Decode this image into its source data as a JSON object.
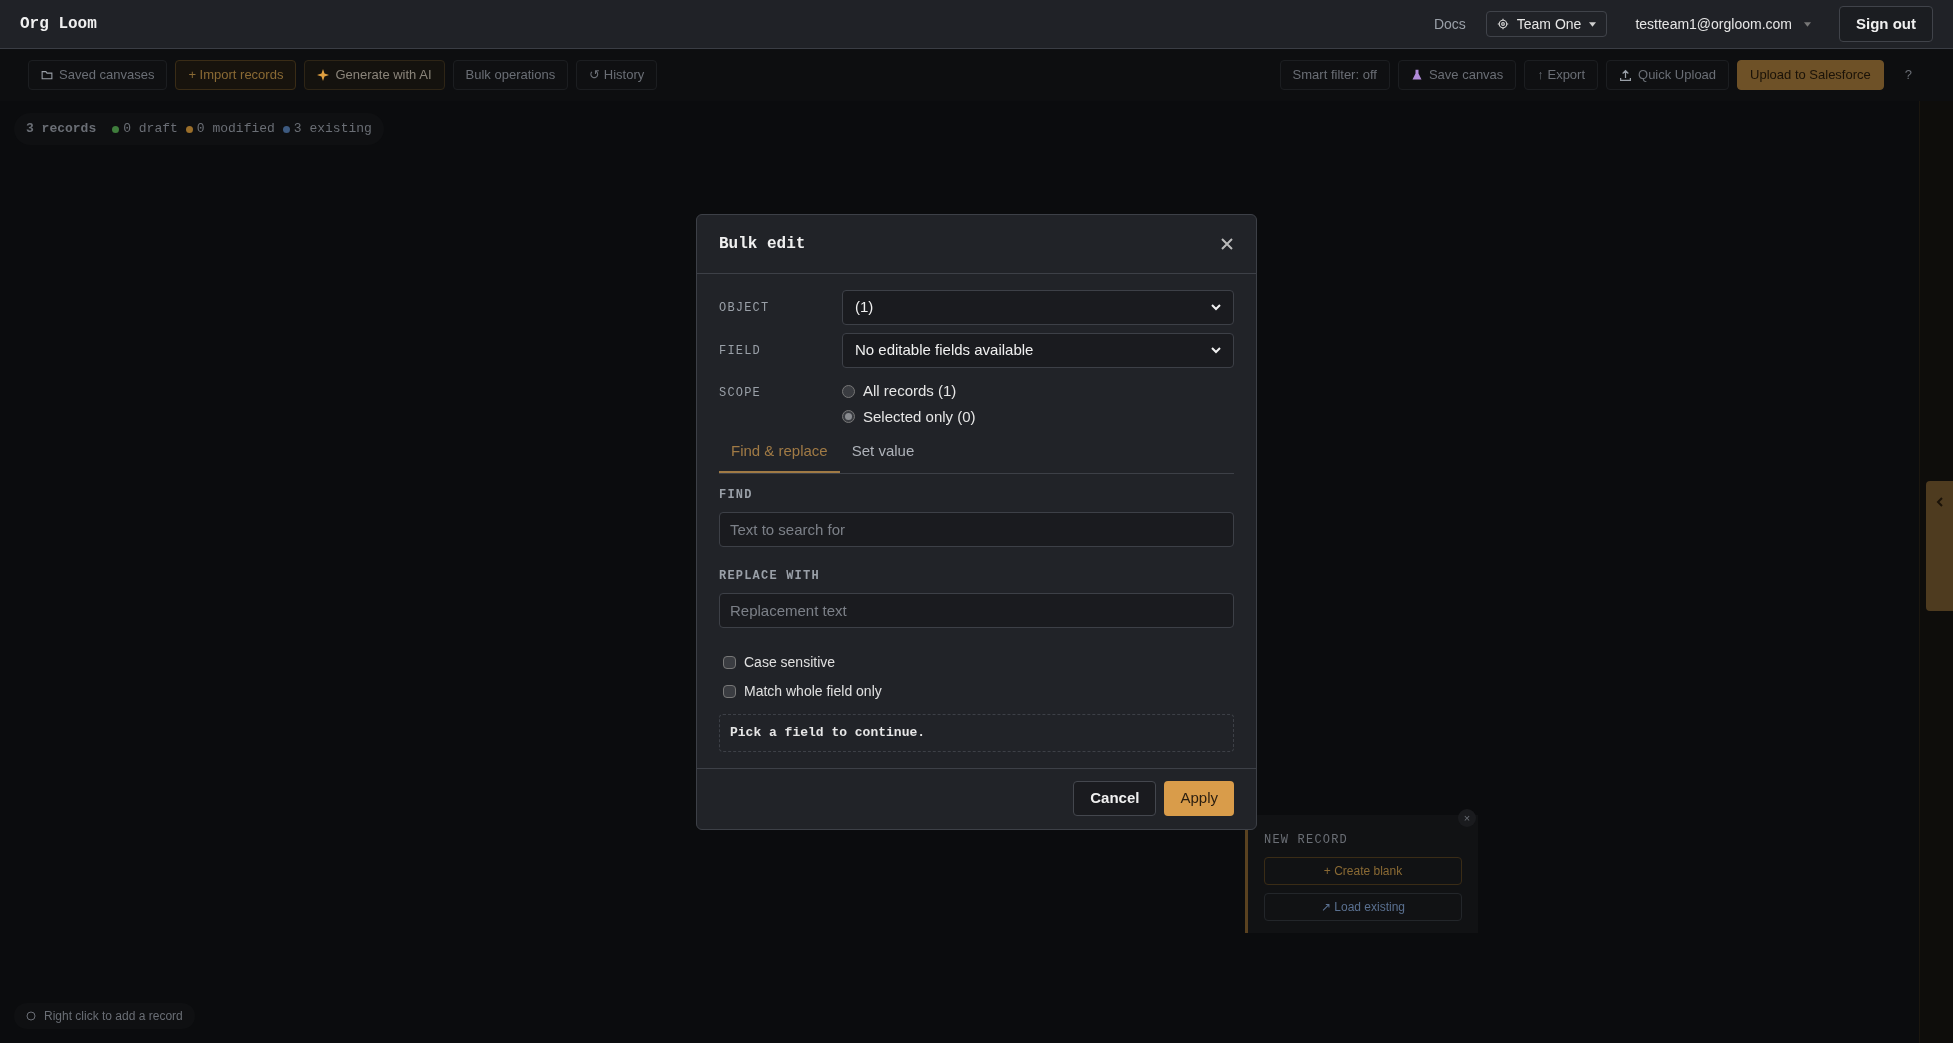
{
  "app": {
    "logo": "Org Loom"
  },
  "header": {
    "docs": "Docs",
    "team": "Team One",
    "email": "testteam1@orgloom.com",
    "sign_out": "Sign out"
  },
  "toolbar": {
    "left": [
      {
        "label": "Saved canvases",
        "kind": "folder"
      },
      {
        "label": "+ Import records",
        "kind": "accent"
      },
      {
        "label": "Generate with AI",
        "kind": "ai"
      },
      {
        "label": "Bulk operations",
        "kind": "plain"
      },
      {
        "label": "↺ History",
        "kind": "plain"
      }
    ],
    "right": [
      {
        "label": "Smart filter: off",
        "kind": "plain"
      },
      {
        "label": "Save canvas",
        "kind": "save"
      },
      {
        "label": "↑ Export",
        "kind": "plain"
      },
      {
        "label": "Quick Upload",
        "kind": "upload"
      },
      {
        "label": "Upload to Salesforce",
        "kind": "primary"
      },
      {
        "label": "?",
        "kind": "ghost"
      }
    ]
  },
  "stats": {
    "total": "3 records",
    "legend": [
      {
        "label": "0 draft",
        "color": "#3f7d3c"
      },
      {
        "label": "0 modified",
        "color": "#9a6e2a"
      },
      {
        "label": "3 existing",
        "color": "#3d5a80"
      }
    ]
  },
  "new_record": {
    "title": "NEW RECORD",
    "close": "×",
    "actions": [
      {
        "label": "+ Create blank",
        "kind": "accent"
      },
      {
        "label": "↗ Load existing",
        "kind": "info"
      }
    ]
  },
  "hint": "Right click to add a record",
  "dialog": {
    "title": "Bulk edit",
    "object": {
      "label": "OBJECT",
      "value": "(1)"
    },
    "field": {
      "label": "FIELD",
      "value": "No editable fields available"
    },
    "scope": {
      "label": "SCOPE",
      "options": [
        {
          "label": "All records (1)",
          "selected": false
        },
        {
          "label": "Selected only (0)",
          "selected": true
        }
      ]
    },
    "tabs": [
      {
        "label": "Find & replace",
        "selected": true
      },
      {
        "label": "Set value",
        "selected": false
      }
    ],
    "find": {
      "label": "FIND",
      "placeholder": "Text to search for"
    },
    "replace": {
      "label": "REPLACE WITH",
      "placeholder": "Replacement text"
    },
    "options": [
      {
        "label": "Case sensitive",
        "checked": false
      },
      {
        "label": "Match whole field only",
        "checked": false
      }
    ],
    "message": "Pick a field to continue.",
    "cancel": "Cancel",
    "apply": "Apply"
  }
}
